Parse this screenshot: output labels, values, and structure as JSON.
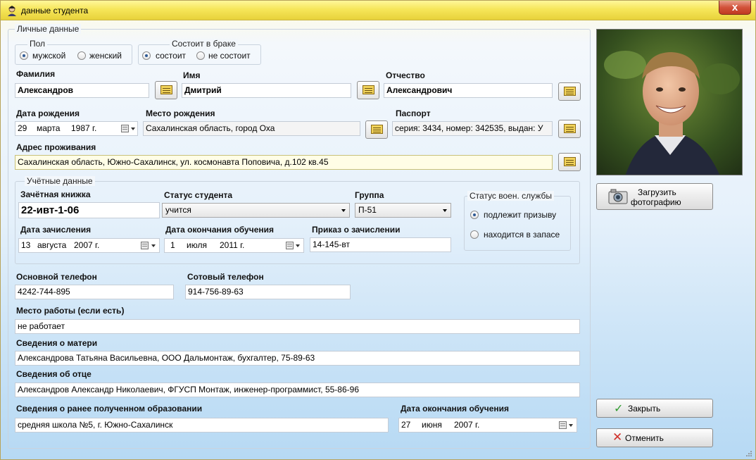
{
  "window": {
    "title": "данные студента",
    "close": "x"
  },
  "personal": {
    "legend": "Личные данные",
    "gender": {
      "legend": "Пол",
      "options": [
        "мужской",
        "женский"
      ]
    },
    "marital": {
      "legend": "Состоит в браке",
      "options": [
        "состоит",
        "не состоит"
      ]
    },
    "surname": {
      "label": "Фамилия",
      "value": "Александров"
    },
    "name": {
      "label": "Имя",
      "value": "Дмитрий"
    },
    "patronymic": {
      "label": "Отчество",
      "value": "Александрович"
    },
    "birth_date": {
      "label": "Дата рождения",
      "day": "29",
      "month": "марта",
      "year": "1987 г."
    },
    "birth_place": {
      "label": "Место рождения",
      "value": "Сахалинская область, город Оха"
    },
    "passport": {
      "label": "Паспорт",
      "value": "серия: 3434, номер: 342535, выдан: У"
    },
    "address": {
      "label": "Адрес проживания",
      "value": "Сахалинская область, Южно-Сахалинск, ул. космонавта Поповича, д.102 кв.45"
    }
  },
  "study": {
    "legend": "Учётные данные",
    "record_book": {
      "label": "Зачётная книжка",
      "value": "22-ивт-1-06"
    },
    "status": {
      "label": "Статус студента",
      "value": "учится"
    },
    "group": {
      "label": "Группа",
      "value": "П-51"
    },
    "military": {
      "legend": "Статус воен. службы",
      "options": [
        "подлежит призыву",
        "находится в запасе"
      ]
    },
    "enroll_date": {
      "label": "Дата зачисления",
      "day": "13",
      "month": "августа",
      "year": "2007 г."
    },
    "end_date": {
      "label": "Дата окончания обучения",
      "day": "1",
      "month": "июля",
      "year": "2011 г."
    },
    "order": {
      "label": "Приказ о зачислении",
      "value": "14-145-вт"
    }
  },
  "contacts": {
    "main_phone": {
      "label": "Основной телефон",
      "value": "4242-744-895"
    },
    "mobile": {
      "label": "Сотовый телефон",
      "value": "914-756-89-63"
    },
    "work": {
      "label": "Место работы (если есть)",
      "value": "не работает"
    },
    "mother": {
      "label": "Сведения о матери",
      "value": "Александрова Татьяна Васильевна, ООО Дальмонтаж, бухгалтер, 75-89-63"
    },
    "father": {
      "label": "Сведения об отце",
      "value": "Александров Александр Николаевич, ФГУСП Монтаж, инженер-программист, 55-86-96"
    },
    "prev_edu": {
      "label": "Сведения о ранее полученном образовании",
      "value": "средняя школа №5, г. Южно-Сахалинск"
    },
    "prev_end": {
      "label": "Дата окончания обучения",
      "day": "27",
      "month": "июня",
      "year": "2007 г."
    }
  },
  "actions": {
    "upload_photo": [
      "Загрузить",
      "фотографию"
    ],
    "ok": "Закрыть",
    "cancel": "Отменить"
  },
  "colors": {
    "title_bar": "#f6e65a",
    "close": "#d2523a",
    "ok_icon": "#3aa53a",
    "cancel_icon": "#d23a2a"
  }
}
